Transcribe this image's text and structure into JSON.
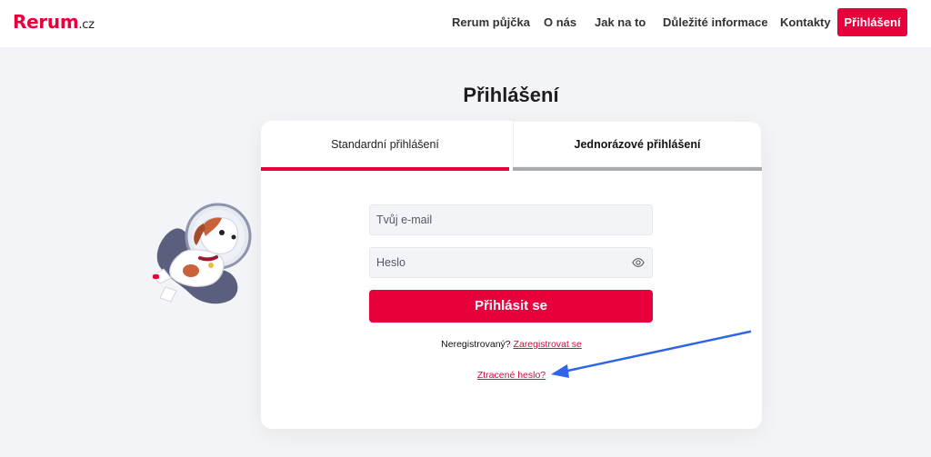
{
  "header": {
    "logo_main": "Rerum",
    "logo_tld": ".cz",
    "nav": [
      "Rerum půjčka",
      "O nás",
      "Jak na to",
      "Důležité informace",
      "Kontakty"
    ],
    "login_button": "Přihlášení"
  },
  "page": {
    "title": "Přihlášení"
  },
  "tabs": {
    "standard": "Standardní přihlášení",
    "one_time": "Jednorázové přihlášení"
  },
  "form": {
    "email_placeholder": "Tvůj e-mail",
    "password_placeholder": "Heslo",
    "submit_label": "Přihlásit se",
    "register_prompt": "Neregistrovaný?",
    "register_link": "Zaregistrovat se",
    "lost_password_link": "Ztracené heslo?"
  },
  "colors": {
    "brand": "#e8003d",
    "arrow": "#2f66e8",
    "inactive_tab": "#a7abb1"
  },
  "icons": {
    "password_toggle": "eye-icon",
    "mascot": "astronaut-dog-illustration",
    "annotation": "blue-arrow-icon"
  }
}
